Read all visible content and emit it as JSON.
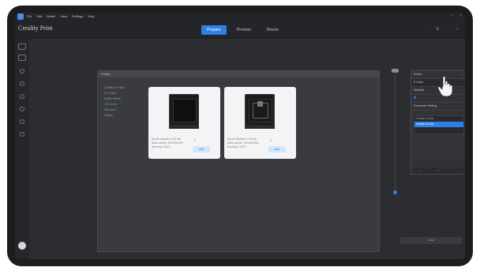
{
  "menu": [
    "File",
    "Edit",
    "Model",
    "View",
    "Settings",
    "Help"
  ],
  "app_title": "Creality Print",
  "tabs": [
    {
      "label": "Prepare",
      "active": true
    },
    {
      "label": "Preview",
      "active": false
    },
    {
      "label": "Device",
      "active": false
    }
  ],
  "dialog": {
    "title": "Printer",
    "brands": [
      "Creality K1 Max",
      "K1 Series",
      "Ender Series",
      "CR Series",
      "Sermoon",
      "Others"
    ],
    "active_brand_index": 3
  },
  "printers": [
    {
      "specs": [
        "Nozzle diameter: 0.40 mm",
        "Build volume: 300×300×300",
        "Bed temp: 100°C"
      ],
      "qty": "1",
      "add_label": "Add"
    },
    {
      "specs": [
        "Nozzle diameter: 0.40 mm",
        "Build volume: 220×220×250",
        "Bed temp: 100°C"
      ],
      "qty": "1",
      "add_label": "Add"
    }
  ],
  "panel": {
    "header": "Printer",
    "printer_name": "K1 Max",
    "material": "Material",
    "section": "Parameter Setting",
    "items": [
      "Creality K1 Max",
      "Creality K1 Max"
    ],
    "selected_index": 1
  },
  "slice_button": "Slice",
  "colors": {
    "accent": "#2f7fe8",
    "dark_bg": "#2b2c30",
    "panel_bg": "#323337"
  },
  "icons": [
    "minimize-icon",
    "maximize-icon",
    "close-icon",
    "settings-icon",
    "user-icon"
  ]
}
